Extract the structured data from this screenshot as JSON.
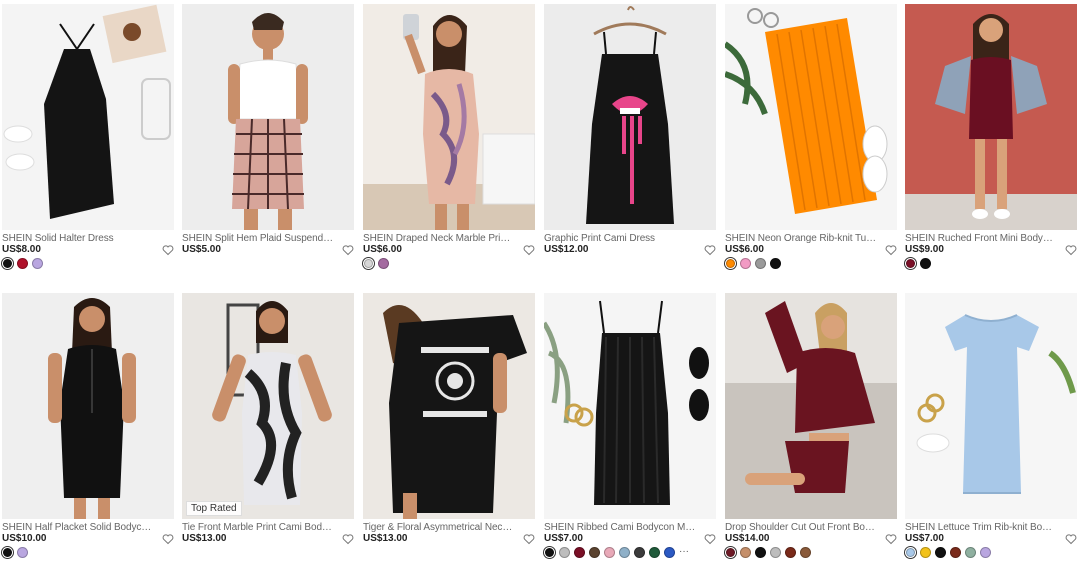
{
  "products": [
    {
      "title": "SHEIN Solid Halter Dress",
      "price": "US$8.00",
      "badge": "",
      "swatches": [
        "#111111",
        "#b0102a",
        "#b9a6e0"
      ],
      "more": ""
    },
    {
      "title": "SHEIN Split Hem Plaid Suspender Skirt",
      "price": "US$5.00",
      "badge": "",
      "swatches": [],
      "more": ""
    },
    {
      "title": "SHEIN Draped Neck Marble Print Dress",
      "price": "US$6.00",
      "badge": "",
      "swatches": [
        "#d7d7d7",
        "#a46aa0"
      ],
      "more": ""
    },
    {
      "title": "Graphic Print Cami Dress",
      "price": "US$12.00",
      "badge": "",
      "swatches": [],
      "more": ""
    },
    {
      "title": "SHEIN Neon Orange Rib-knit Tube Dress",
      "price": "US$6.00",
      "badge": "",
      "swatches": [
        "#ff8a00",
        "#f29ac4",
        "#9a9a9a",
        "#111111"
      ],
      "more": ""
    },
    {
      "title": "SHEIN Ruched Front Mini Bodycon Dress",
      "price": "US$9.00",
      "badge": "",
      "swatches": [
        "#7a0f26",
        "#111111"
      ],
      "more": ""
    },
    {
      "title": "SHEIN Half Placket Solid Bodycon Dress",
      "price": "US$10.00",
      "badge": "",
      "swatches": [
        "#111111",
        "#b9a6e0"
      ],
      "more": ""
    },
    {
      "title": "Tie Front Marble Print Cami Bodycon Dress",
      "price": "US$13.00",
      "badge": "Top Rated",
      "swatches": [],
      "more": ""
    },
    {
      "title": "Tiger & Floral Asymmetrical Neck Dress",
      "price": "US$13.00",
      "badge": "",
      "swatches": [],
      "more": ""
    },
    {
      "title": "SHEIN Ribbed Cami Bodycon Mini Dress",
      "price": "US$7.00",
      "badge": "",
      "swatches": [
        "#111111",
        "#bdbdbd",
        "#7a0f26",
        "#5b4330",
        "#e8a9b8",
        "#8fb0c8",
        "#3b3b3b",
        "#1f5a3a",
        "#2b59c3"
      ],
      "more": "···"
    },
    {
      "title": "Drop Shoulder Cut Out Front Bodycon Dress",
      "price": "US$14.00",
      "badge": "",
      "swatches": [
        "#6e1a26",
        "#c58f6a",
        "#111111",
        "#bdbdbd",
        "#7a2a1a",
        "#8a5a3a"
      ],
      "more": ""
    },
    {
      "title": "SHEIN Lettuce Trim Rib-knit Bodycon Dress",
      "price": "US$7.00",
      "badge": "",
      "swatches": [
        "#a8c8e8",
        "#f2c21a",
        "#111111",
        "#7a2a1a",
        "#8fb0a0",
        "#b9a6e0"
      ],
      "more": ""
    }
  ]
}
